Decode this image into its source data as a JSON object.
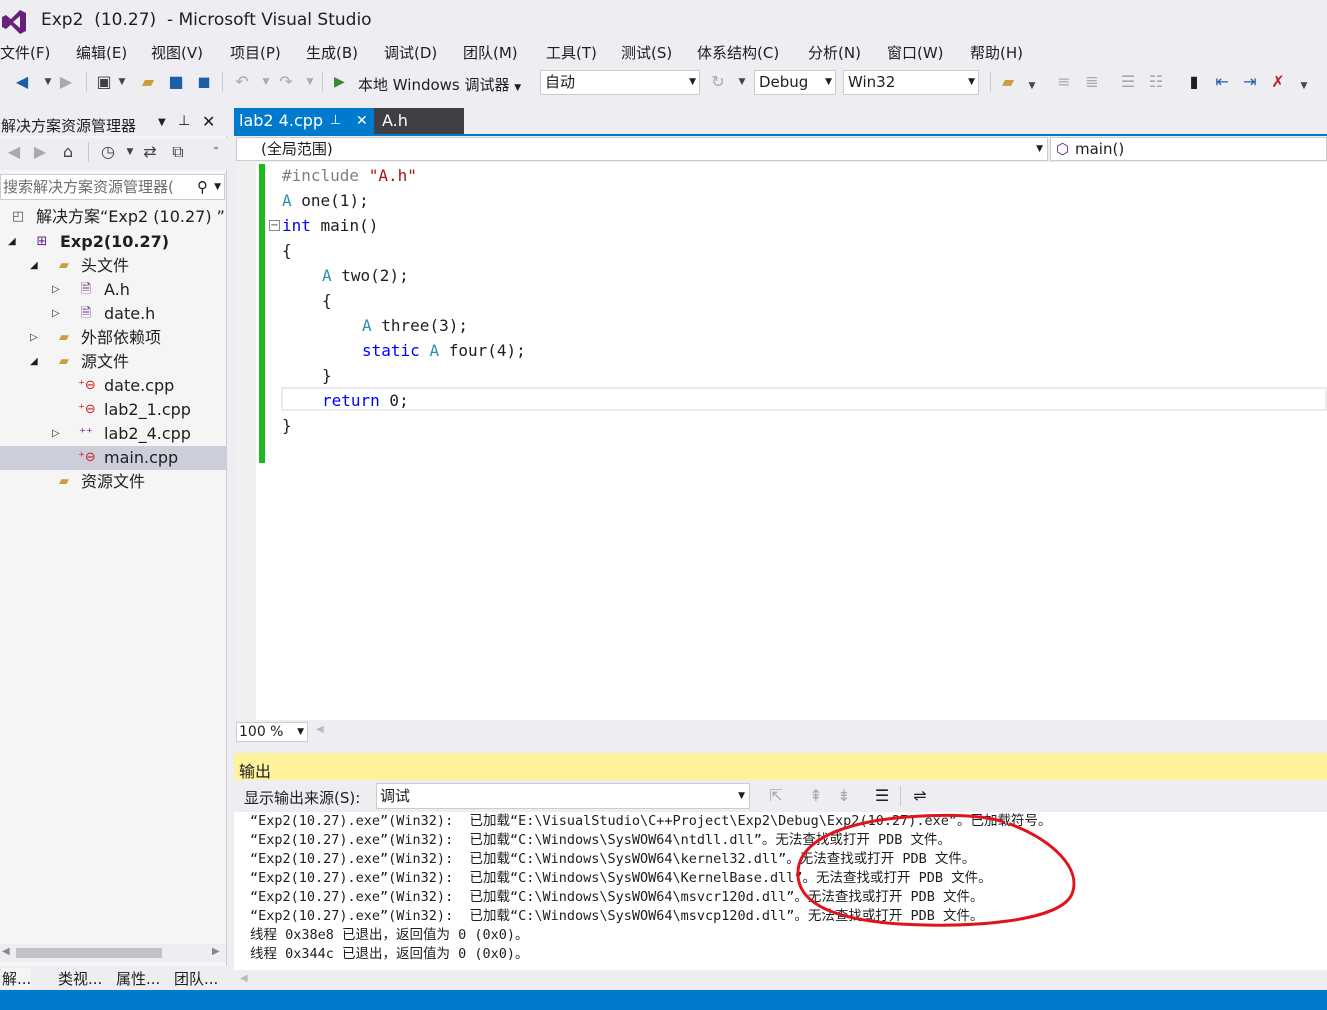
{
  "window": {
    "title": "Exp2  (10.27)  - Microsoft Visual Studio"
  },
  "menu": [
    "文件(F)",
    "编辑(E)",
    "视图(V)",
    "项目(P)",
    "生成(B)",
    "调试(D)",
    "团队(M)",
    "工具(T)",
    "测试(S)",
    "体系结构(C)",
    "分析(N)",
    "窗口(W)",
    "帮助(H)"
  ],
  "toolbar": {
    "debugger_label": "本地 Windows 调试器",
    "mode_value": "自动",
    "config_value": "Debug",
    "platform_value": "Win32"
  },
  "solution_explorer": {
    "title": "解决方案资源管理器",
    "search_placeholder": "搜索解决方案资源管理器(",
    "tree": [
      {
        "label": "解决方案“Exp2  (10.27)  ”(",
        "bold": false
      },
      {
        "label": "Exp2(10.27)",
        "bold": true
      },
      {
        "label": "头文件"
      },
      {
        "label": "A.h"
      },
      {
        "label": "date.h"
      },
      {
        "label": "外部依赖项"
      },
      {
        "label": "源文件"
      },
      {
        "label": "date.cpp"
      },
      {
        "label": "lab2_1.cpp"
      },
      {
        "label": "lab2_4.cpp"
      },
      {
        "label": "main.cpp"
      },
      {
        "label": "资源文件"
      }
    ],
    "bottom_tabs": [
      "解...",
      "类视...",
      "属性...",
      "团队..."
    ]
  },
  "editor": {
    "tabs": [
      {
        "label": "lab2 4.cpp",
        "active": true
      },
      {
        "label": "A.h",
        "active": false
      }
    ],
    "scope_left": "(全局范围)",
    "scope_right": "main()",
    "zoom": "100 %",
    "code": {
      "l1_pp": "#include",
      "l1_str": "\"A.h\"",
      "l2_ty": "A",
      "l2_rest": " one(1);",
      "l3_kw": "int",
      "l3_rest": " main()",
      "l4": "{",
      "l5_ty": "A",
      "l5_rest": " two(2);",
      "l6": "{",
      "l7_ty": "A",
      "l7_rest": " three(3);",
      "l8_kw": "static",
      "l8_ty": "A",
      "l8_rest": " four(4);",
      "l9": "}",
      "l10_kw": "return",
      "l10_rest": " 0;",
      "l11": "}"
    }
  },
  "output": {
    "title": "输出",
    "source_label": "显示输出来源(S):",
    "source_value": "调试",
    "lines": [
      "“Exp2(10.27).exe”(Win32):  已加载“E:\\VisualStudio\\C++Project\\Exp2\\Debug\\Exp2(10.27).exe”。已加载符号。",
      "“Exp2(10.27).exe”(Win32):  已加载“C:\\Windows\\SysWOW64\\ntdll.dll”。无法查找或打开 PDB 文件。",
      "“Exp2(10.27).exe”(Win32):  已加载“C:\\Windows\\SysWOW64\\kernel32.dll”。无法查找或打开 PDB 文件。",
      "“Exp2(10.27).exe”(Win32):  已加载“C:\\Windows\\SysWOW64\\KernelBase.dll”。无法查找或打开 PDB 文件。",
      "“Exp2(10.27).exe”(Win32):  已加载“C:\\Windows\\SysWOW64\\msvcr120d.dll”。无法查找或打开 PDB 文件。",
      "“Exp2(10.27).exe”(Win32):  已加载“C:\\Windows\\SysWOW64\\msvcp120d.dll”。无法查找或打开 PDB 文件。",
      "线程 0x38e8 已退出，返回值为 0 (0x0)。",
      "线程 0x344c 已退出，返回值为 0 (0x0)。"
    ]
  },
  "colors": {
    "accent": "#007acc",
    "output_header": "#fff29d",
    "annotation_circle": "#e0141e",
    "change_bar": "#1eb91e"
  }
}
